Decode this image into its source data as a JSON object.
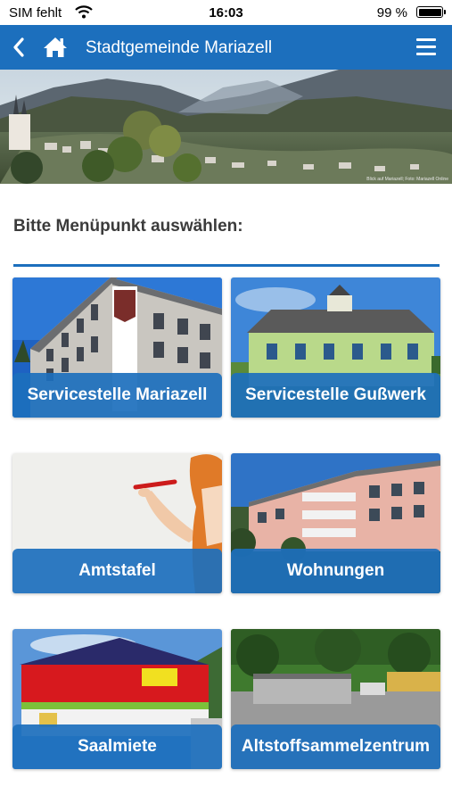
{
  "status_bar": {
    "carrier": "SIM fehlt",
    "time": "16:03",
    "battery": "99 %"
  },
  "navbar": {
    "title": "Stadtgemeinde Mariazell",
    "back_icon": "chevron-left-icon",
    "home_icon": "home-icon",
    "menu_icon": "hamburger-menu-icon"
  },
  "hero": {
    "credit": "Blick auf Mariazell; Foto: Mariazell Online"
  },
  "content": {
    "prompt": "Bitte Menüpunkt auswählen:"
  },
  "tiles": [
    {
      "label": "Servicestelle Mariazell"
    },
    {
      "label": "Servicestelle Gußwerk"
    },
    {
      "label": "Amtstafel"
    },
    {
      "label": "Wohnungen"
    },
    {
      "label": "Saalmiete"
    },
    {
      "label": "Altstoffsammelzentrum"
    }
  ],
  "colors": {
    "accent": "#1c6fbd",
    "text": "#3b3b3b"
  }
}
